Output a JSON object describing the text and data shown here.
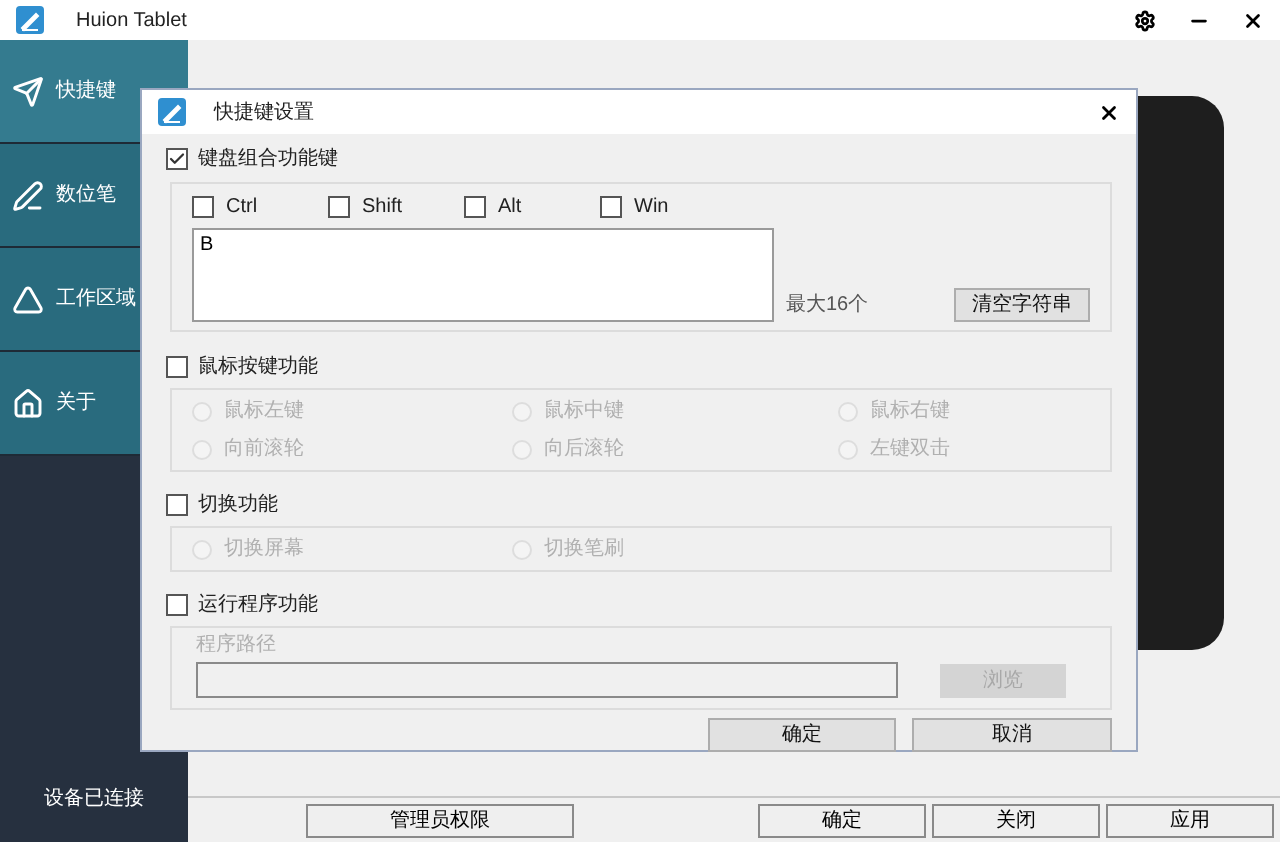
{
  "window": {
    "title": "Huion Tablet"
  },
  "sidebar": {
    "items": [
      {
        "label": "快捷键",
        "kind": "send",
        "selected": true
      },
      {
        "label": "数位笔",
        "kind": "pen",
        "selected": false
      },
      {
        "label": "工作区域",
        "kind": "ruler",
        "selected": false
      },
      {
        "label": "关于",
        "kind": "home",
        "selected": false
      }
    ],
    "status": "设备已连接"
  },
  "dialog": {
    "title": "快捷键设置",
    "keyboard": {
      "label": "键盘组合功能键",
      "checked": true,
      "modifiers": [
        {
          "label": "Ctrl",
          "checked": false
        },
        {
          "label": "Shift",
          "checked": false
        },
        {
          "label": "Alt",
          "checked": false
        },
        {
          "label": "Win",
          "checked": false
        }
      ],
      "value": "B",
      "hint": "最大16个",
      "clear_button": "清空字符串"
    },
    "mouse": {
      "label": "鼠标按键功能",
      "checked": false,
      "options": [
        {
          "label": "鼠标左键",
          "selected": false
        },
        {
          "label": "鼠标中键",
          "selected": false
        },
        {
          "label": "鼠标右键",
          "selected": false
        },
        {
          "label": "向前滚轮",
          "selected": false
        },
        {
          "label": "向后滚轮",
          "selected": false
        },
        {
          "label": "左键双击",
          "selected": false
        }
      ]
    },
    "switch": {
      "label": "切换功能",
      "checked": false,
      "options": [
        {
          "label": "切换屏幕",
          "selected": false
        },
        {
          "label": "切换笔刷",
          "selected": false
        }
      ]
    },
    "program": {
      "label": "运行程序功能",
      "checked": false,
      "path_label": "程序路径",
      "browse_button": "浏览"
    },
    "buttons": [
      "确定",
      "取消"
    ]
  },
  "bottom_buttons": [
    "管理员权限",
    "确定",
    "关闭",
    "应用"
  ]
}
